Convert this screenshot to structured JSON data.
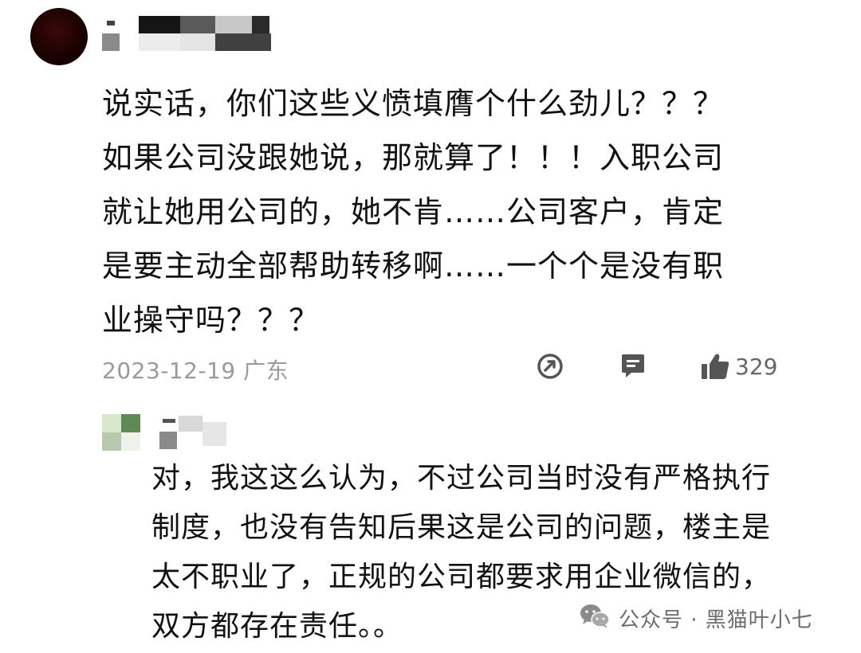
{
  "comment": {
    "text": "说实话，你们这些义愤填膺个什么劲儿？？？\n如果公司没跟她说，那就算了！！！入职公司\n就让她用公司的，她不肯……公司客户，肯定\n是要主动全部帮助转移啊……一个个是没有职\n业操守吗？？？",
    "date_location": "2023-12-19 广东",
    "likes": "329"
  },
  "reply": {
    "text": "对，我这这么认为，不过公司当时没有严格执行\n制度，也没有告知后果这是公司的问题，楼主是\n太不职业了，正规的公司都要求用企业微信的，\n双方都存在责任。。"
  },
  "watermark": {
    "text": "公众号 · 黑猫叶小七",
    "icon": "wechat-icon"
  },
  "colors": {
    "text": "#111111",
    "meta": "#9a9a9a",
    "icon": "#555555"
  }
}
